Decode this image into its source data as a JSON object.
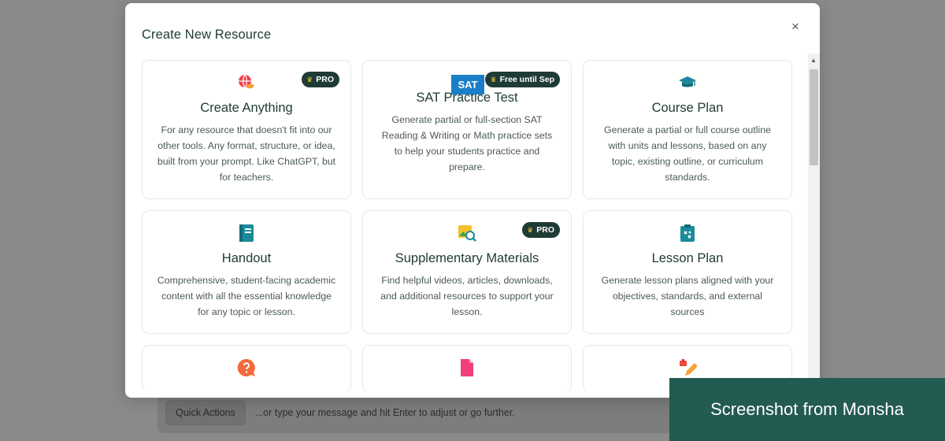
{
  "background": {
    "quick_actions_label": "Quick Actions",
    "message_placeholder": "...or type your message and hit Enter to adjust or go further."
  },
  "modal": {
    "title": "Create New Resource",
    "close_glyph": "×"
  },
  "cards": [
    {
      "title": "Create Anything",
      "description": "For any resource that doesn't fit into our other tools. Any format, structure, or idea, built from your prompt. Like ChatGPT, but for teachers.",
      "badge": "PRO",
      "icon": "globe-hand-icon"
    },
    {
      "title": "SAT Practice Test",
      "description": "Generate partial or full-section SAT Reading & Writing or Math practice sets to help your students practice and prepare.",
      "badge": "Free until Sep",
      "logo_text": "SAT",
      "icon": "sat-logo"
    },
    {
      "title": "Course Plan",
      "description": "Generate a partial or full course outline with units and lessons, based on any topic, existing outline, or curriculum standards.",
      "icon": "graduation-cap-icon"
    },
    {
      "title": "Handout",
      "description": "Comprehensive, student-facing academic content with all the essential knowledge for any topic or lesson.",
      "icon": "notebook-icon"
    },
    {
      "title": "Supplementary Materials",
      "description": "Find helpful videos, articles, downloads, and additional resources to support your lesson.",
      "badge": "PRO",
      "icon": "image-search-icon"
    },
    {
      "title": "Lesson Plan",
      "description": "Generate lesson plans aligned with your objectives, standards, and external sources",
      "icon": "clipboard-icon"
    },
    {
      "icon": "question-bubble-icon"
    },
    {
      "icon": "document-icon"
    },
    {
      "icon": "pencil-toolbox-icon"
    }
  ],
  "badge_crown_glyph": "♛",
  "watermark": "Screenshot from Monsha",
  "colors": {
    "badge_bg": "#1f3b35",
    "crown": "#e8c040",
    "teal_icon": "#1a8a9a",
    "orange_icon": "#f26b3a",
    "pink_icon": "#ef3f7a",
    "sat_blue": "#1a7ec8",
    "watermark_bg": "#235a52"
  }
}
